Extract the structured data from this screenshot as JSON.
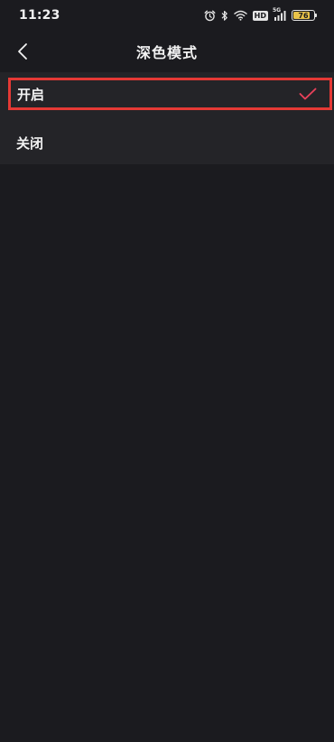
{
  "status_bar": {
    "time": "11:23",
    "hd_label": "HD",
    "signal_label": "5G",
    "battery_level": "76"
  },
  "header": {
    "title": "深色模式"
  },
  "options": [
    {
      "label": "开启",
      "selected": true
    },
    {
      "label": "关闭",
      "selected": false
    }
  ],
  "colors": {
    "background": "#1b1b1f",
    "list_background": "#242428",
    "accent": "#e8415a",
    "highlight_border": "#e53935",
    "battery_fill": "#e9c34a"
  }
}
